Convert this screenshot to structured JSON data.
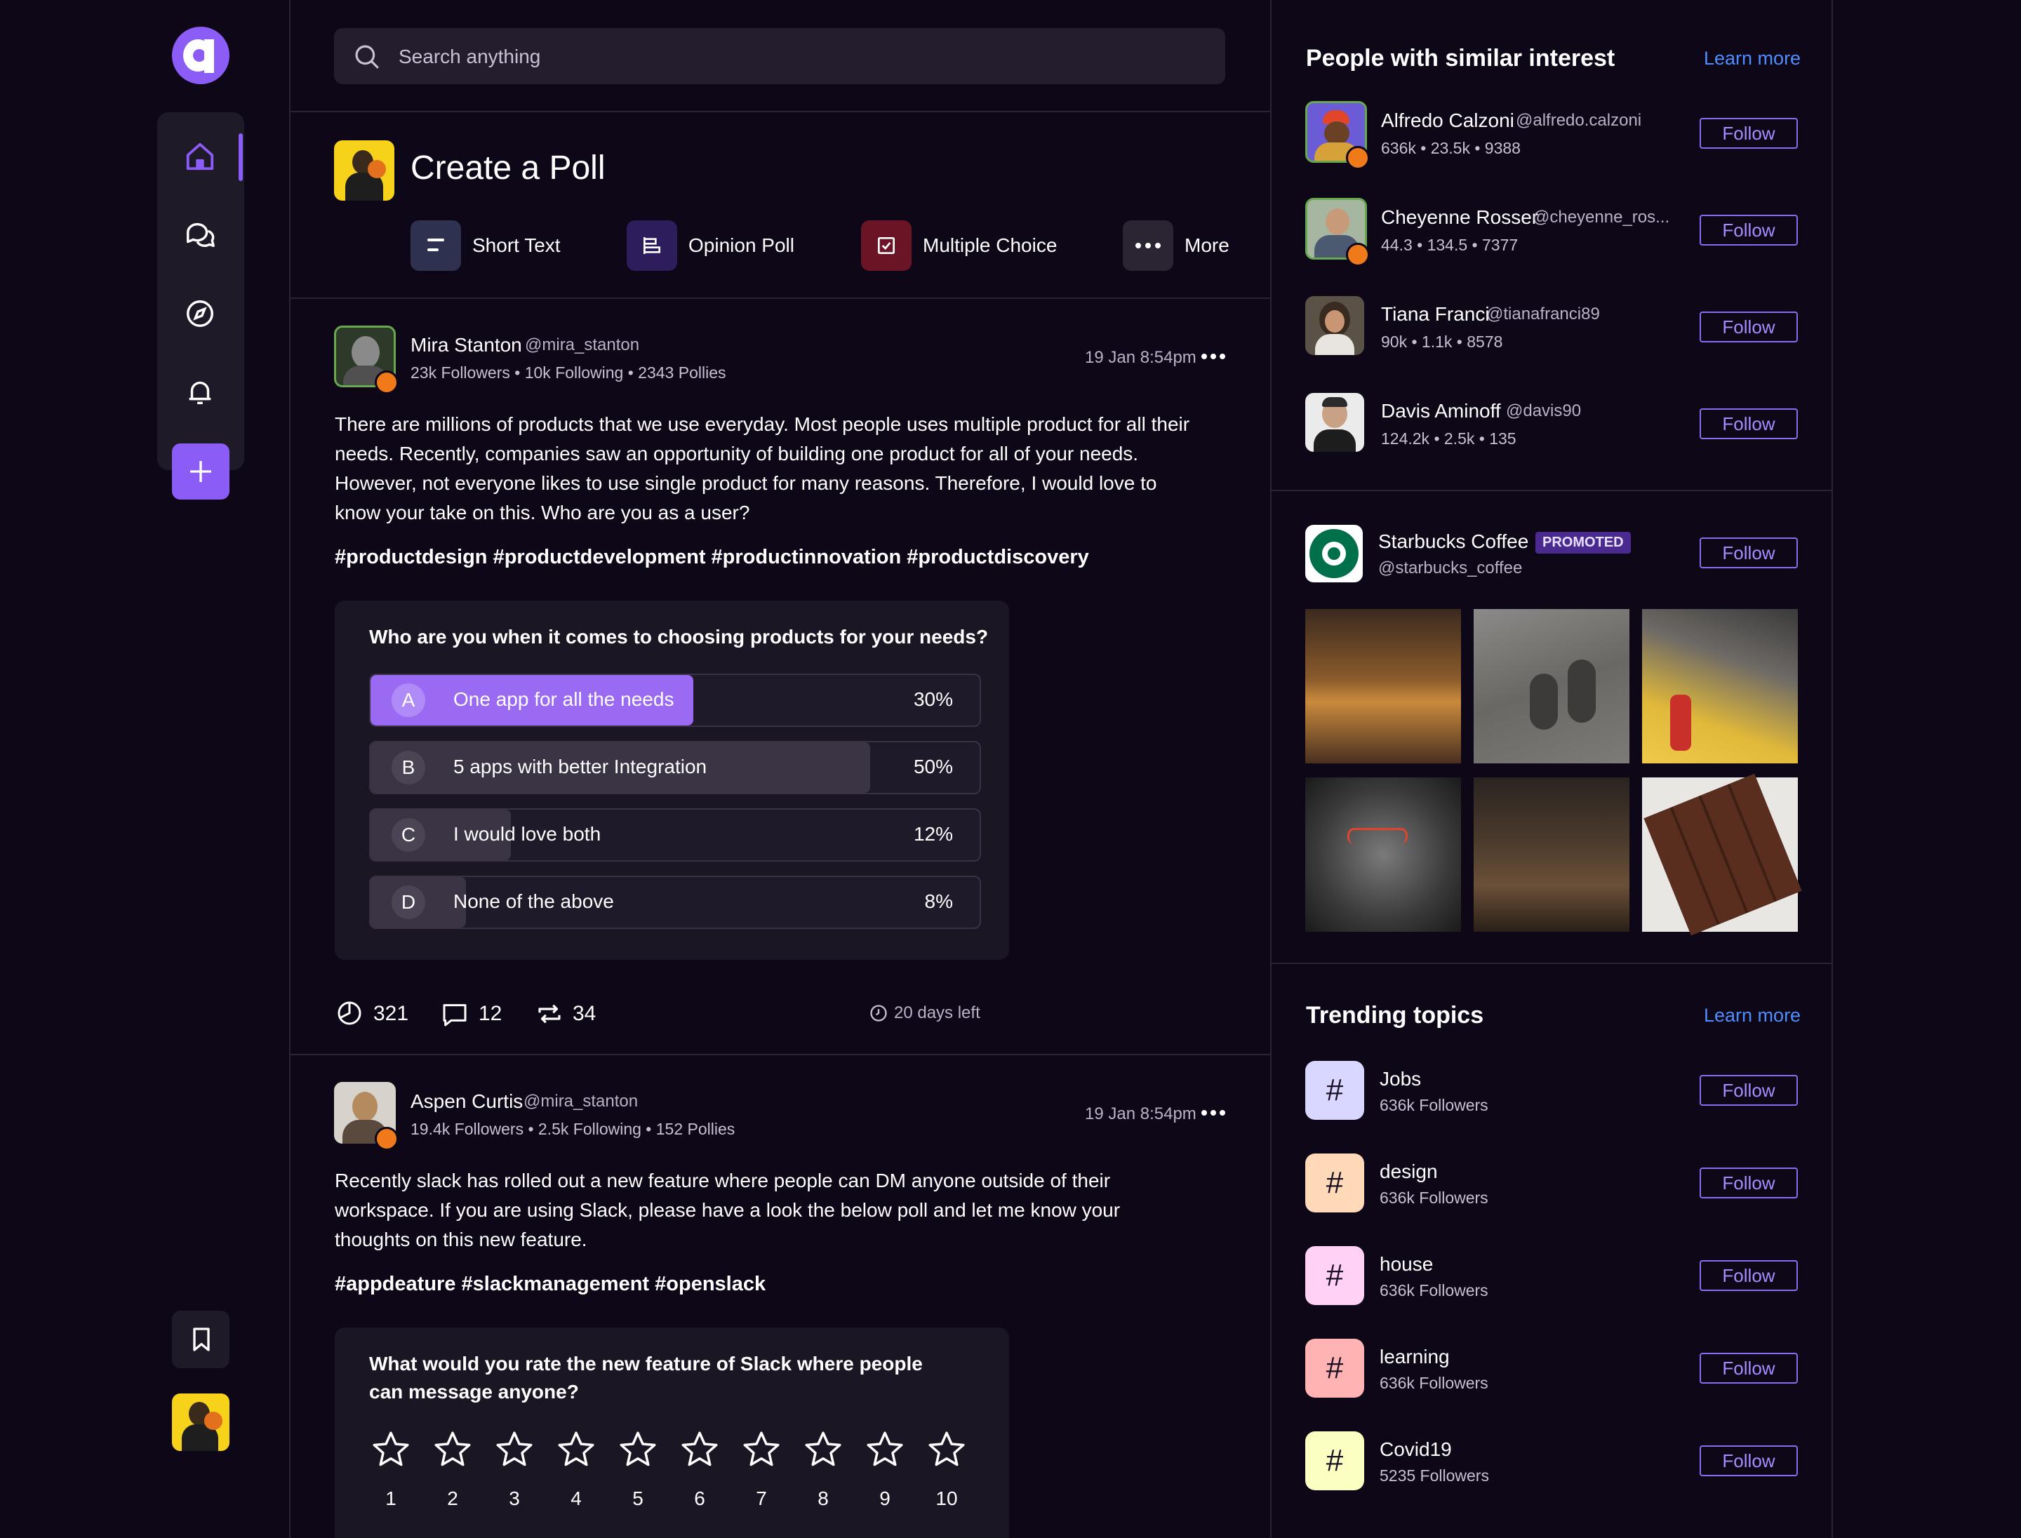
{
  "colors": {
    "background": "#0e0718",
    "accent": "#8b5cf6",
    "follow_border": "#8b6cf0",
    "link": "#4f8dff"
  },
  "search": {
    "placeholder": "Search anything"
  },
  "nav": {
    "items": [
      "home-icon",
      "chat-icon",
      "compass-icon",
      "bell-icon",
      "plus-icon"
    ],
    "bottom": [
      "bookmark-icon"
    ]
  },
  "create_poll": {
    "title": "Create a Poll",
    "options": [
      {
        "label": "Short Text",
        "icon": "short-text-icon",
        "color": "#2e3150"
      },
      {
        "label": "Opinion Poll",
        "icon": "opinion-poll-icon",
        "color": "#2e1d5c"
      },
      {
        "label": "Multiple Choice",
        "icon": "checkbox-icon",
        "color": "#6b1426"
      },
      {
        "label": "More",
        "icon": "more-icon",
        "color": "#2a2433"
      }
    ]
  },
  "posts": [
    {
      "author": "Mira Stanton",
      "handle": "@mira_stanton",
      "stats": "23k Followers • 10k Following • 2343 Pollies",
      "time": "19 Jan 8:54pm",
      "body": "There are millions of products that we use everyday. Most people uses multiple product for all their needs. Recently, companies saw an opportunity of building one product for all of your needs. However, not everyone likes to use single product for many reasons. Therefore, I would love to know your take on this. Who are you as a user?",
      "tags": "#productdesign #productdevelopment #productinnovation #productdiscovery",
      "poll": {
        "question": "Who are you when it comes to choosing products for your needs?",
        "options": [
          {
            "letter": "A",
            "text": "One app for all the needs",
            "pct": "30%",
            "value": 0.3
          },
          {
            "letter": "B",
            "text": "5 apps with better Integration",
            "pct": "50%",
            "value": 0.5
          },
          {
            "letter": "C",
            "text": "I would love both",
            "pct": "12%",
            "value": 0.12
          },
          {
            "letter": "D",
            "text": "None of the above",
            "pct": "8%",
            "value": 0.08
          }
        ]
      },
      "votes": "321",
      "comments": "12",
      "reposts": "34",
      "time_left": "20 days left"
    },
    {
      "author": "Aspen Curtis",
      "handle": "@mira_stanton",
      "stats": "19.4k Followers • 2.5k Following • 152 Pollies",
      "time": "19 Jan 8:54pm",
      "body": "Recently slack has rolled out a new feature where people can DM anyone outside of their workspace. If you are using Slack, please have a look the below poll and let me know your thoughts on this new feature.",
      "tags": "#appdeature #slackmanagement #openslack",
      "poll": {
        "question": "What would you rate the new feature of Slack where people can message anyone?",
        "ratings": [
          "1",
          "2",
          "3",
          "4",
          "5",
          "6",
          "7",
          "8",
          "9",
          "10"
        ]
      }
    }
  ],
  "people": {
    "title": "People with similar interest",
    "learn_more": "Learn more",
    "follow_label": "Follow",
    "items": [
      {
        "name": "Alfredo Calzoni",
        "handle": "@alfredo.calzoni",
        "stats": "636k • 23.5k • 9388"
      },
      {
        "name": "Cheyenne Rosser",
        "handle": "@cheyenne_ros...",
        "stats": "44.3 • 134.5 • 7377"
      },
      {
        "name": "Tiana Franci",
        "handle": "@tianafranci89",
        "stats": "90k • 1.1k • 8578"
      },
      {
        "name": "Davis Aminoff",
        "handle": "@davis90",
        "stats": "124.2k • 2.5k • 135"
      }
    ]
  },
  "promoted": {
    "name": "Starbucks Coffee",
    "badge": "PROMOTED",
    "handle": "@starbucks_coffee",
    "follow_label": "Follow",
    "images": [
      "restaurant-photo",
      "shadows-photo",
      "food-photo",
      "statue-photo",
      "bottles-photo",
      "chocolate-photo"
    ]
  },
  "trending": {
    "title": "Trending topics",
    "learn_more": "Learn more",
    "follow_label": "Follow",
    "items": [
      {
        "name": "Jobs",
        "followers": "636k Followers",
        "color": "#d9d6ff"
      },
      {
        "name": "design",
        "followers": "636k Followers",
        "color": "#ffd9b8"
      },
      {
        "name": "house",
        "followers": "636k Followers",
        "color": "#ffd1f4"
      },
      {
        "name": "learning",
        "followers": "636k Followers",
        "color": "#ffb3b3"
      },
      {
        "name": "Covid19",
        "followers": "5235 Followers",
        "color": "#fbffc2"
      }
    ]
  }
}
